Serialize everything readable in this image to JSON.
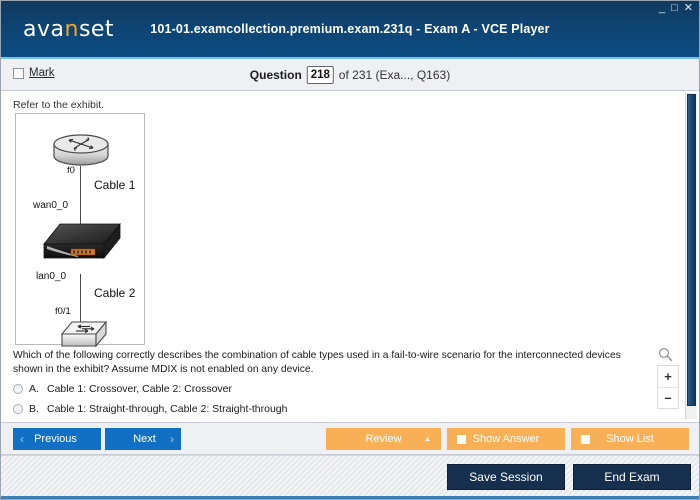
{
  "window": {
    "title": "101-01.examcollection.premium.exam.231q - Exam A - VCE Player",
    "logo_text_a": "ava",
    "logo_text_hi": "n",
    "logo_text_b": "set",
    "minimize": "_",
    "maximize": "□",
    "close": "✕"
  },
  "question_bar": {
    "mark_label": "Mark",
    "question_label": "Question",
    "question_number": "218",
    "of_text": "of 231 (Exa..., Q163)"
  },
  "content": {
    "refer_text": "Refer to the exhibit.",
    "question_text": "Which of the following correctly describes the combination of cable types used in a fail-to-wire scenario for the interconnected devices shown in the exhibit? Assume MDIX is not enabled on any device.",
    "answers": [
      {
        "letter": "A.",
        "text": "Cable 1: Crossover, Cable 2: Crossover"
      },
      {
        "letter": "B.",
        "text": "Cable 1: Straight-through, Cable 2: Straight-through"
      }
    ],
    "zoom_in": "+",
    "zoom_out": "–"
  },
  "exhibit": {
    "label_f0": "f0",
    "label_cable1": "Cable 1",
    "label_wan": "wan0_0",
    "label_lan": "lan0_0",
    "label_cable2": "Cable 2",
    "label_f01": "f0/1"
  },
  "toolbar": {
    "previous": "Previous",
    "next": "Next",
    "review": "Review",
    "review_arrow": "▲",
    "show_answer": "Show Answer",
    "show_list": "Show List",
    "chevron_left": "‹",
    "chevron_right": "›"
  },
  "footer": {
    "save_session": "Save Session",
    "end_exam": "End Exam"
  },
  "colors": {
    "header_navy": "#0e4473",
    "accent_blue": "#1270c4",
    "accent_orange": "#f7b055",
    "logo_orange": "#f5a623",
    "footer_navy": "#152f4d"
  }
}
